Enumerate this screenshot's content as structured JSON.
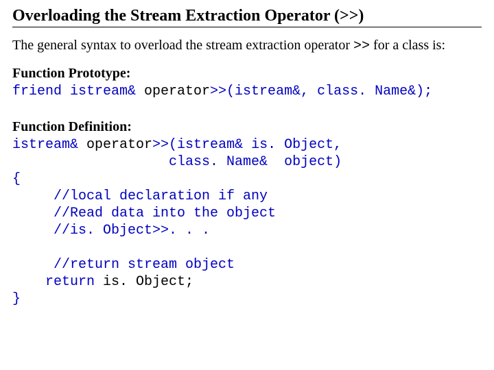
{
  "title": "Overloading the Stream Extraction Operator (>>)",
  "intro_a": "The general syntax to overload the stream extraction operator ",
  "intro_sym": ">>",
  "intro_b": " for a class is:",
  "proto_label": "Function Prototype:",
  "proto_code": {
    "p1": "friend istream& ",
    "p2": "operator",
    "p3": ">>(istream&, class. Name&);"
  },
  "def_label": "Function Definition:",
  "def_code": {
    "l1a": "istream& ",
    "l1b": "operator",
    "l1c": ">>(istream& is. Object,",
    "l2": "                   class. Name&  object)",
    "l3": "{",
    "l4": "     //local declaration if any",
    "l5": "     //Read data into the object",
    "l6": "     //is. Object>>. . .",
    "l7": "",
    "l8": "     //return stream object",
    "l9a": "    return ",
    "l9b": "is. Object;",
    "l10": "}"
  }
}
